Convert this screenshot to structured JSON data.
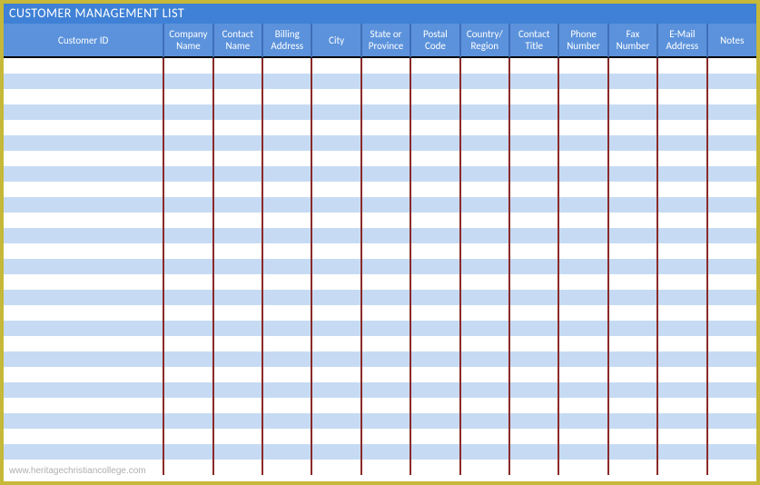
{
  "title": "CUSTOMER MANAGEMENT LIST",
  "columns": [
    "Customer ID",
    "Company Name",
    "Contact Name",
    "Billing Address",
    "City",
    "State or Province",
    "Postal Code",
    "Country/ Region",
    "Contact Title",
    "Phone Number",
    "Fax Number",
    "E-Mail Address",
    "Notes"
  ],
  "rows": [
    [
      "",
      "",
      "",
      "",
      "",
      "",
      "",
      "",
      "",
      "",
      "",
      "",
      ""
    ],
    [
      "",
      "",
      "",
      "",
      "",
      "",
      "",
      "",
      "",
      "",
      "",
      "",
      ""
    ],
    [
      "",
      "",
      "",
      "",
      "",
      "",
      "",
      "",
      "",
      "",
      "",
      "",
      ""
    ],
    [
      "",
      "",
      "",
      "",
      "",
      "",
      "",
      "",
      "",
      "",
      "",
      "",
      ""
    ],
    [
      "",
      "",
      "",
      "",
      "",
      "",
      "",
      "",
      "",
      "",
      "",
      "",
      ""
    ],
    [
      "",
      "",
      "",
      "",
      "",
      "",
      "",
      "",
      "",
      "",
      "",
      "",
      ""
    ],
    [
      "",
      "",
      "",
      "",
      "",
      "",
      "",
      "",
      "",
      "",
      "",
      "",
      ""
    ],
    [
      "",
      "",
      "",
      "",
      "",
      "",
      "",
      "",
      "",
      "",
      "",
      "",
      ""
    ],
    [
      "",
      "",
      "",
      "",
      "",
      "",
      "",
      "",
      "",
      "",
      "",
      "",
      ""
    ],
    [
      "",
      "",
      "",
      "",
      "",
      "",
      "",
      "",
      "",
      "",
      "",
      "",
      ""
    ],
    [
      "",
      "",
      "",
      "",
      "",
      "",
      "",
      "",
      "",
      "",
      "",
      "",
      ""
    ],
    [
      "",
      "",
      "",
      "",
      "",
      "",
      "",
      "",
      "",
      "",
      "",
      "",
      ""
    ],
    [
      "",
      "",
      "",
      "",
      "",
      "",
      "",
      "",
      "",
      "",
      "",
      "",
      ""
    ],
    [
      "",
      "",
      "",
      "",
      "",
      "",
      "",
      "",
      "",
      "",
      "",
      "",
      ""
    ],
    [
      "",
      "",
      "",
      "",
      "",
      "",
      "",
      "",
      "",
      "",
      "",
      "",
      ""
    ],
    [
      "",
      "",
      "",
      "",
      "",
      "",
      "",
      "",
      "",
      "",
      "",
      "",
      ""
    ],
    [
      "",
      "",
      "",
      "",
      "",
      "",
      "",
      "",
      "",
      "",
      "",
      "",
      ""
    ],
    [
      "",
      "",
      "",
      "",
      "",
      "",
      "",
      "",
      "",
      "",
      "",
      "",
      ""
    ],
    [
      "",
      "",
      "",
      "",
      "",
      "",
      "",
      "",
      "",
      "",
      "",
      "",
      ""
    ],
    [
      "",
      "",
      "",
      "",
      "",
      "",
      "",
      "",
      "",
      "",
      "",
      "",
      ""
    ],
    [
      "",
      "",
      "",
      "",
      "",
      "",
      "",
      "",
      "",
      "",
      "",
      "",
      ""
    ],
    [
      "",
      "",
      "",
      "",
      "",
      "",
      "",
      "",
      "",
      "",
      "",
      "",
      ""
    ],
    [
      "",
      "",
      "",
      "",
      "",
      "",
      "",
      "",
      "",
      "",
      "",
      "",
      ""
    ],
    [
      "",
      "",
      "",
      "",
      "",
      "",
      "",
      "",
      "",
      "",
      "",
      "",
      ""
    ],
    [
      "",
      "",
      "",
      "",
      "",
      "",
      "",
      "",
      "",
      "",
      "",
      "",
      ""
    ],
    [
      "",
      "",
      "",
      "",
      "",
      "",
      "",
      "",
      "",
      "",
      "",
      "",
      ""
    ],
    [
      "",
      "",
      "",
      "",
      "",
      "",
      "",
      "",
      "",
      "",
      "",
      "",
      ""
    ]
  ],
  "watermark": "www.heritagechristiancollege.com"
}
